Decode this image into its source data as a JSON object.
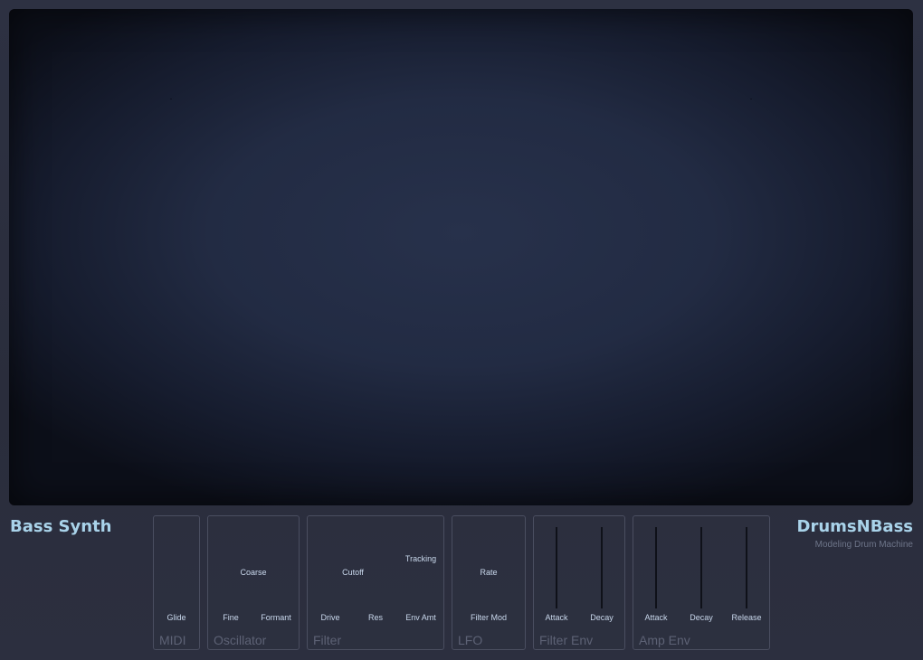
{
  "app": {
    "title": "Bass Synth",
    "brand": "DrumsNBass",
    "brand_subtitle": "Modeling Drum Machine"
  },
  "sections": {
    "midi": {
      "name": "MIDI",
      "glide": "Glide"
    },
    "oscillator": {
      "name": "Oscillator",
      "coarse": "Coarse",
      "fine": "Fine",
      "formant": "Formant"
    },
    "filter": {
      "name": "Filter",
      "cutoff": "Cutoff",
      "tracking": "Tracking",
      "drive": "Drive",
      "res": "Res",
      "env_amt": "Env Amt"
    },
    "lfo": {
      "name": "LFO",
      "rate": "Rate",
      "filter_mod": "Filter Mod"
    },
    "filter_env": {
      "name": "Filter Env",
      "attack": "Attack",
      "decay": "Decay"
    },
    "amp_env": {
      "name": "Amp Env",
      "attack": "Attack",
      "decay": "Decay",
      "release": "Release"
    }
  },
  "colors": {
    "accent": "#a9d3ea",
    "label": "#c9d8ec",
    "section_label": "#5d6275",
    "panel_border": "#4a4e60"
  }
}
